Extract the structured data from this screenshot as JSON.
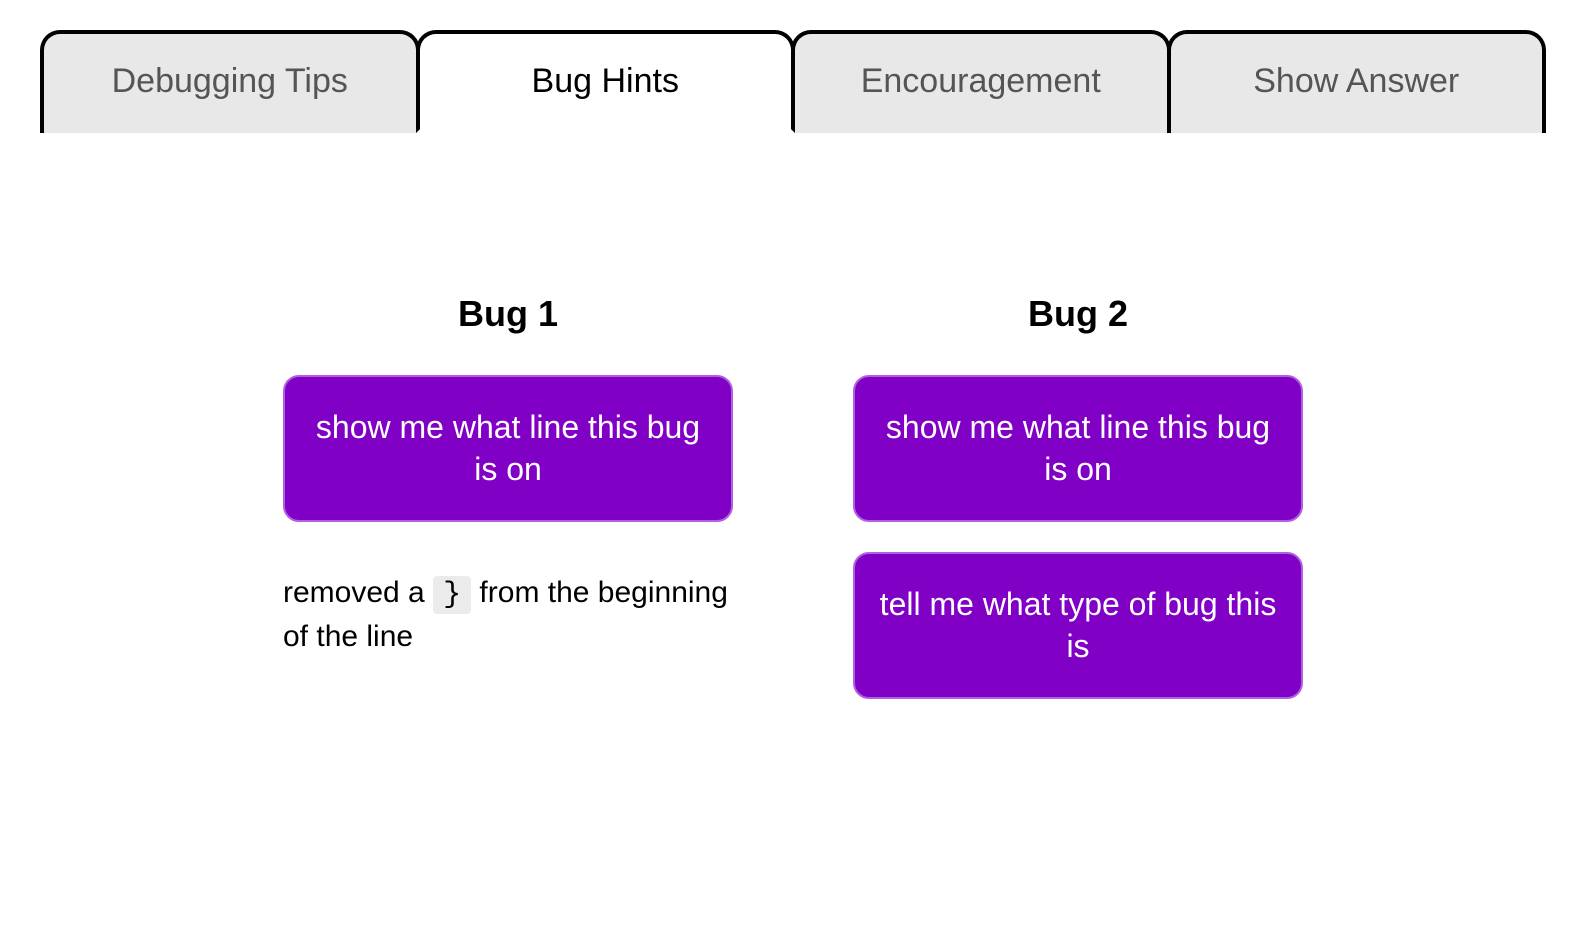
{
  "tabs": [
    {
      "label": "Debugging Tips",
      "active": false
    },
    {
      "label": "Bug Hints",
      "active": true
    },
    {
      "label": "Encouragement",
      "active": false
    },
    {
      "label": "Show Answer",
      "active": false
    }
  ],
  "bugs": {
    "bug1": {
      "title": "Bug 1",
      "show_line_label": "show me what line this bug is on",
      "hint_prefix": "removed a ",
      "hint_code": "}",
      "hint_suffix": " from the beginning of the line"
    },
    "bug2": {
      "title": "Bug 2",
      "show_line_label": "show me what line this bug is on",
      "tell_type_label": "tell me what type of bug this is"
    }
  }
}
